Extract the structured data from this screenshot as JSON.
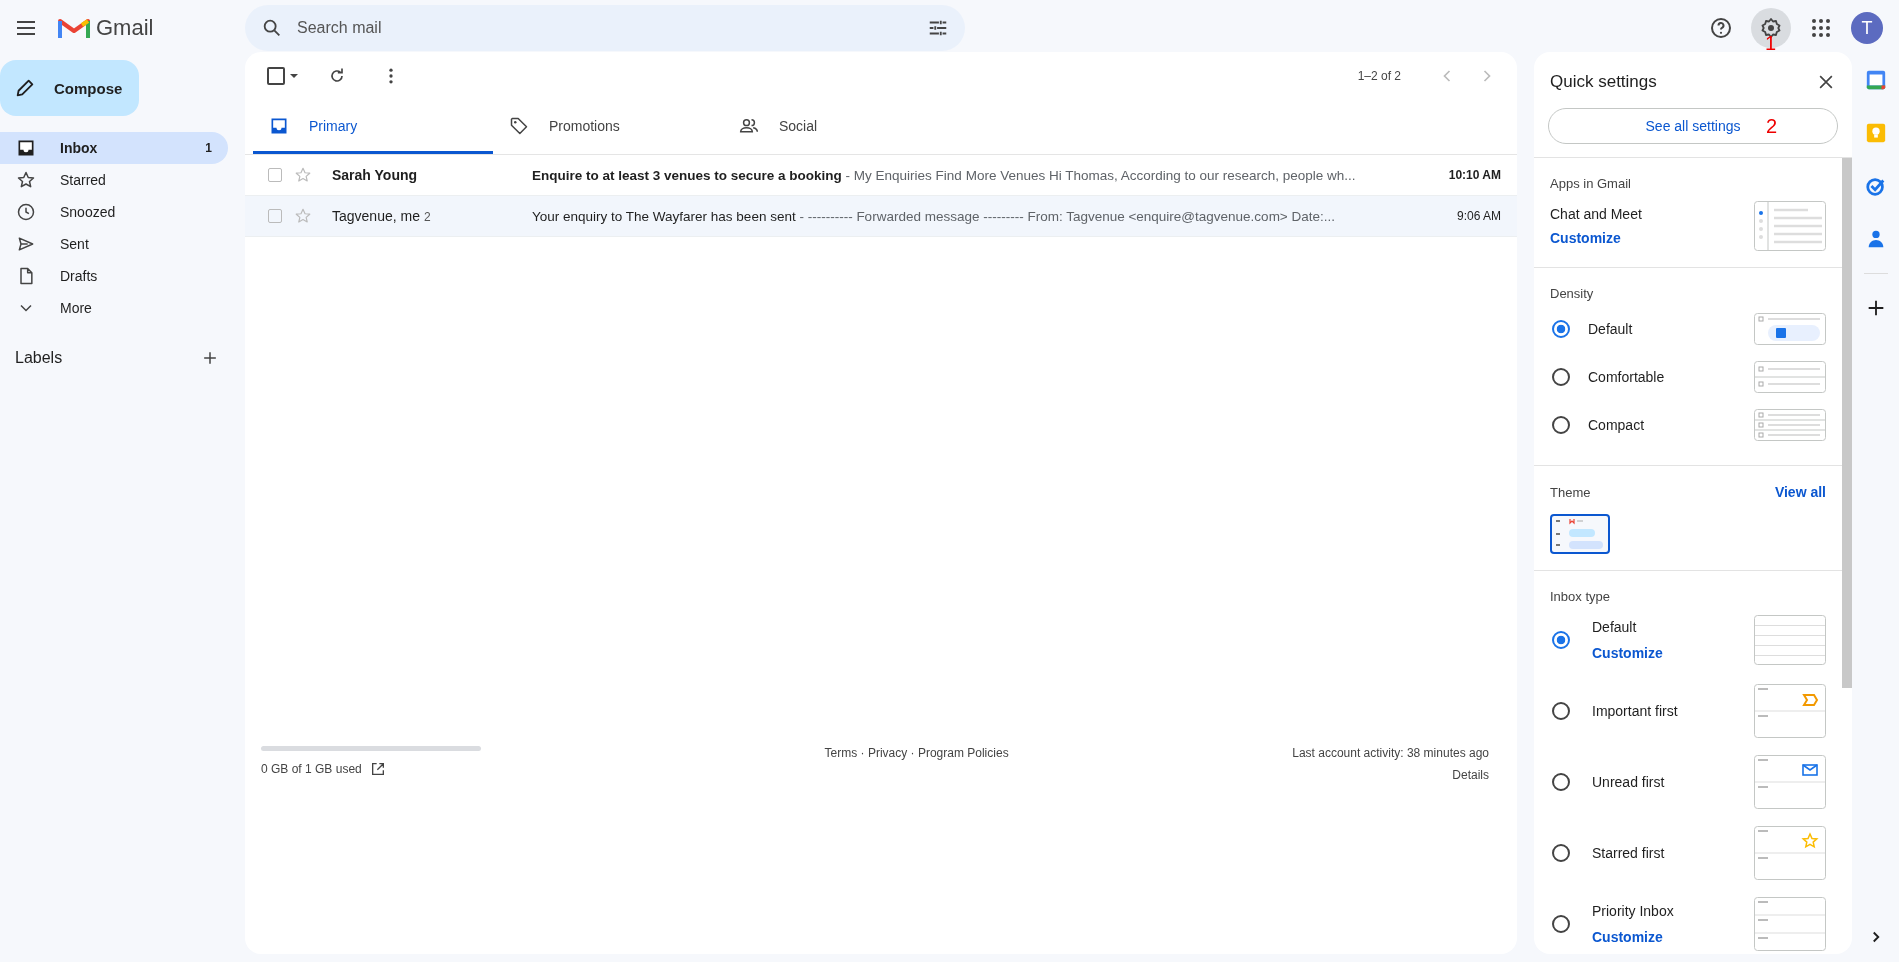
{
  "header": {
    "app_name": "Gmail",
    "search": {
      "placeholder": "Search mail"
    },
    "settings_marker": "1",
    "avatar_initial": "T"
  },
  "compose": "Compose",
  "nav": [
    {
      "kind": "inbox",
      "label": "Inbox",
      "count": "1",
      "selected": true
    },
    {
      "kind": "star",
      "label": "Starred",
      "selected": false
    },
    {
      "kind": "clock",
      "label": "Snoozed",
      "selected": false
    },
    {
      "kind": "send",
      "label": "Sent",
      "selected": false
    },
    {
      "kind": "file",
      "label": "Drafts",
      "selected": false
    },
    {
      "kind": "chevron",
      "label": "More",
      "selected": false
    }
  ],
  "labels_heading": "Labels",
  "toolbar": {
    "select_all_checked": false,
    "pagination": "1–2 of 2"
  },
  "tabs": [
    {
      "kind": "inbox",
      "label": "Primary",
      "selected": true
    },
    {
      "kind": "tag",
      "label": "Promotions",
      "selected": false
    },
    {
      "kind": "people",
      "label": "Social",
      "selected": false
    }
  ],
  "emails": [
    {
      "sender": "Sarah Young",
      "checked": false,
      "unread": true,
      "subject": "Enquire to at least 3 venues to secure a booking",
      "snippet": " - My Enquiries Find More Venues Hi Thomas, According to our research, people wh...",
      "time": "10:10 AM"
    },
    {
      "sender": "Tagvenue, me",
      "thread_count": "2",
      "checked": false,
      "unread": false,
      "subject": "Your enquiry to The Wayfarer has been sent",
      "snippet": " - ---------- Forwarded message --------- From: Tagvenue <enquire@tagvenue.com> Date:...",
      "time": "9:06 AM"
    }
  ],
  "footer": {
    "storage": {
      "level": 0,
      "text": "0 GB of 1 GB used"
    },
    "links": "Terms · Privacy · Program Policies",
    "activity": "Last account activity: 38 minutes ago",
    "details": "Details"
  },
  "quick_settings": {
    "title": "Quick settings",
    "see_all": "See all settings",
    "see_all_marker": "2",
    "apps": {
      "heading": "Apps in Gmail",
      "label": "Chat and Meet",
      "link": "Customize"
    },
    "density": {
      "heading": "Density",
      "options": [
        {
          "kind": "default",
          "label": "Default",
          "selected": true
        },
        {
          "kind": "comfortable",
          "label": "Comfortable",
          "selected": false
        },
        {
          "kind": "compact",
          "label": "Compact",
          "selected": false
        }
      ]
    },
    "theme": {
      "heading": "Theme",
      "link": "View all"
    },
    "inbox_type": {
      "heading": "Inbox type",
      "options": [
        {
          "kind": "default",
          "label": "Default",
          "link": "Customize",
          "selected": true
        },
        {
          "kind": "important",
          "label": "Important first",
          "selected": false
        },
        {
          "kind": "unread",
          "label": "Unread first",
          "selected": false
        },
        {
          "kind": "starred",
          "label": "Starred first",
          "selected": false
        },
        {
          "kind": "priority",
          "label": "Priority Inbox",
          "link": "Customize",
          "selected": false
        }
      ]
    }
  }
}
